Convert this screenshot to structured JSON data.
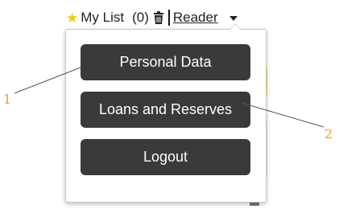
{
  "topbar": {
    "mylist_label": "My List",
    "mylist_count": "(0)",
    "reader_label": "Reader"
  },
  "menu": {
    "items": [
      {
        "label": "Personal Data"
      },
      {
        "label": "Loans and Reserves"
      },
      {
        "label": "Logout"
      }
    ]
  },
  "callouts": {
    "one": "1",
    "two": "2"
  },
  "colors": {
    "star": "#f2c811",
    "button_bg": "#3a3a3a",
    "button_text": "#ffffff",
    "callout_number": "#f0a21b",
    "callout_line": "#555555"
  },
  "icons": {
    "star": "star-icon",
    "trash": "trash-icon",
    "caret": "chevron-down-icon"
  }
}
